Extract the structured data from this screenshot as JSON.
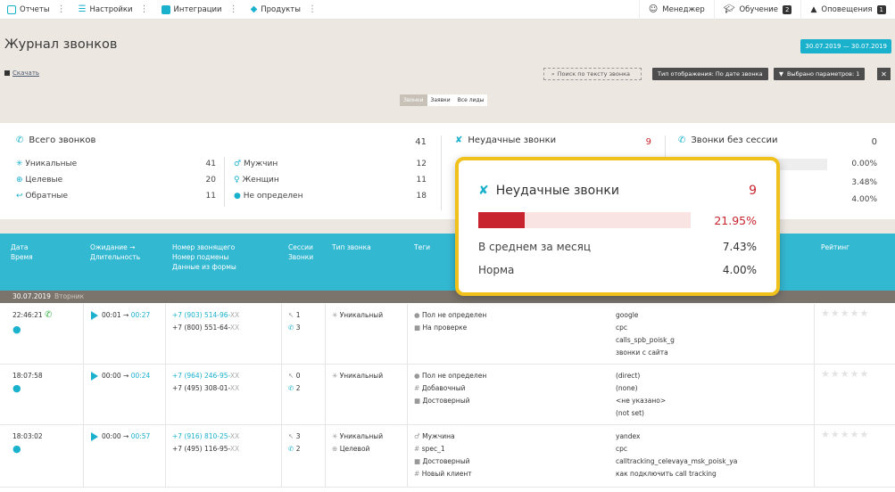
{
  "topbar": {
    "tabs": [
      {
        "label": "Отчеты"
      },
      {
        "label": "Настройки"
      },
      {
        "label": "Интеграции"
      },
      {
        "label": "Продукты"
      }
    ],
    "manager": "Менеджер",
    "learning": "Обучение",
    "learning_badge": "2",
    "notifications": "Оповещения",
    "notifications_badge": "1"
  },
  "header": {
    "title": "Журнал звонков",
    "date_range": "30.07.2019 — 30.07.2019",
    "download": "Скачать",
    "search": "Поиск по тексту звонка",
    "view_mode": "Тип отображения: По дате звонка",
    "filter": "Выбрано параметров: 1",
    "filter_close": "✕",
    "segments": [
      "Звонки",
      "Заявки",
      "Все лиды"
    ]
  },
  "stats": {
    "total": {
      "label": "Всего звонков",
      "value": "41"
    },
    "unique": {
      "label": "Уникальные",
      "value": "41"
    },
    "target": {
      "label": "Целевые",
      "value": "20"
    },
    "callback": {
      "label": "Обратные",
      "value": "11"
    },
    "men": {
      "label": "Мужчин",
      "value": "12"
    },
    "women": {
      "label": "Женщин",
      "value": "11"
    },
    "undefined": {
      "label": "Не определен",
      "value": "18"
    },
    "failed": {
      "label": "Неудачные звонки",
      "value": "9"
    },
    "no_session": {
      "label": "Звонки без сессии",
      "value": "0"
    },
    "no_session_pcts": [
      "0.00%",
      "3.48%",
      "4.00%"
    ]
  },
  "popup": {
    "title": "Неудачные звонки",
    "value": "9",
    "bar_fraction": 0.2195,
    "bar_percent": "21.95%",
    "avg_label": "В среднем за месяц",
    "avg_value": "7.43%",
    "norm_label": "Норма",
    "norm_value": "4.00%"
  },
  "table": {
    "headers": {
      "date": "Дата\nВремя",
      "wait": "Ожидание →\nДлительность",
      "number": "Номер звонящего\nНомер подмены\nДанные из формы",
      "sessions": "Сессии\nЗвонки",
      "type": "Тип звонка",
      "tags": "Теги",
      "rating": "Рейтинг"
    },
    "date_group": {
      "date": "30.07.2019",
      "weekday": "Вторник"
    },
    "rows": [
      {
        "time": "22:46:21",
        "wait": "00:01",
        "duration": "00:27",
        "caller": "+7 (903) 514-96-",
        "substitute": "+7 (800) 551-64-",
        "mask": "XX",
        "sessions": "1",
        "calls": "3",
        "type1": "Уникальный",
        "type2": "",
        "tags": [
          "Пол не определен",
          "На проверке"
        ],
        "source": [
          "google",
          "cpc",
          "calls_spb_poisk_g",
          "звонки с сайта"
        ]
      },
      {
        "time": "18:07:58",
        "wait": "00:00",
        "duration": "00:24",
        "caller": "+7 (964) 246-95-",
        "substitute": "+7 (495) 308-01-",
        "mask": "XX",
        "sessions": "0",
        "calls": "2",
        "type1": "Уникальный",
        "type2": "",
        "tags": [
          "Пол не определен",
          "Добавочный",
          "Достоверный"
        ],
        "source": [
          "(direct)",
          "(none)",
          "<не указано>",
          "(not set)"
        ]
      },
      {
        "time": "18:03:02",
        "wait": "00:00",
        "duration": "00:57",
        "caller": "+7 (916) 810-25-",
        "substitute": "+7 (495) 116-95-",
        "mask": "XX",
        "sessions": "3",
        "calls": "2",
        "type1": "Уникальный",
        "type2": "Целевой",
        "tags": [
          "Мужчина",
          "spec_1",
          "Достоверный",
          "Новый клиент"
        ],
        "source": [
          "yandex",
          "cpc",
          "calltracking_celevaya_msk_poisk_ya",
          "как подключить call tracking"
        ]
      }
    ]
  },
  "colors": {
    "accent": "#1ab1cd",
    "danger": "#c8242f",
    "highlight": "#f0c11a",
    "header_bg": "#ece7e1"
  }
}
